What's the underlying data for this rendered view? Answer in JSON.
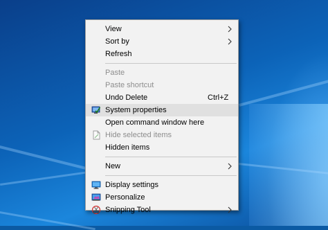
{
  "menu": {
    "items": [
      {
        "label": "View",
        "shortcut": "",
        "submenu": true,
        "disabled": false,
        "icon": ""
      },
      {
        "label": "Sort by",
        "shortcut": "",
        "submenu": true,
        "disabled": false,
        "icon": ""
      },
      {
        "label": "Refresh",
        "shortcut": "",
        "submenu": false,
        "disabled": false,
        "icon": ""
      },
      {
        "label": "Paste",
        "shortcut": "",
        "submenu": false,
        "disabled": true,
        "icon": ""
      },
      {
        "label": "Paste shortcut",
        "shortcut": "",
        "submenu": false,
        "disabled": true,
        "icon": ""
      },
      {
        "label": "Undo Delete",
        "shortcut": "Ctrl+Z",
        "submenu": false,
        "disabled": false,
        "icon": ""
      },
      {
        "label": "System properties",
        "shortcut": "",
        "submenu": false,
        "disabled": false,
        "icon": "system-properties-icon",
        "highlighted": true
      },
      {
        "label": "Open command window here",
        "shortcut": "",
        "submenu": false,
        "disabled": false,
        "icon": ""
      },
      {
        "label": "Hide selected items",
        "shortcut": "",
        "submenu": false,
        "disabled": true,
        "icon": "document-icon"
      },
      {
        "label": "Hidden items",
        "shortcut": "",
        "submenu": false,
        "disabled": false,
        "icon": ""
      },
      {
        "label": "New",
        "shortcut": "",
        "submenu": true,
        "disabled": false,
        "icon": ""
      },
      {
        "label": "Display settings",
        "shortcut": "",
        "submenu": false,
        "disabled": false,
        "icon": "display-icon"
      },
      {
        "label": "Personalize",
        "shortcut": "",
        "submenu": false,
        "disabled": false,
        "icon": "personalize-icon"
      },
      {
        "label": "Snipping Tool",
        "shortcut": "",
        "submenu": true,
        "disabled": false,
        "icon": "snipping-tool-icon"
      }
    ]
  },
  "colors": {
    "menu_background": "#f2f2f2",
    "highlight": "#e0e0e0",
    "disabled_text": "#8d8d8d",
    "desktop_blue": "#0c63b8"
  }
}
